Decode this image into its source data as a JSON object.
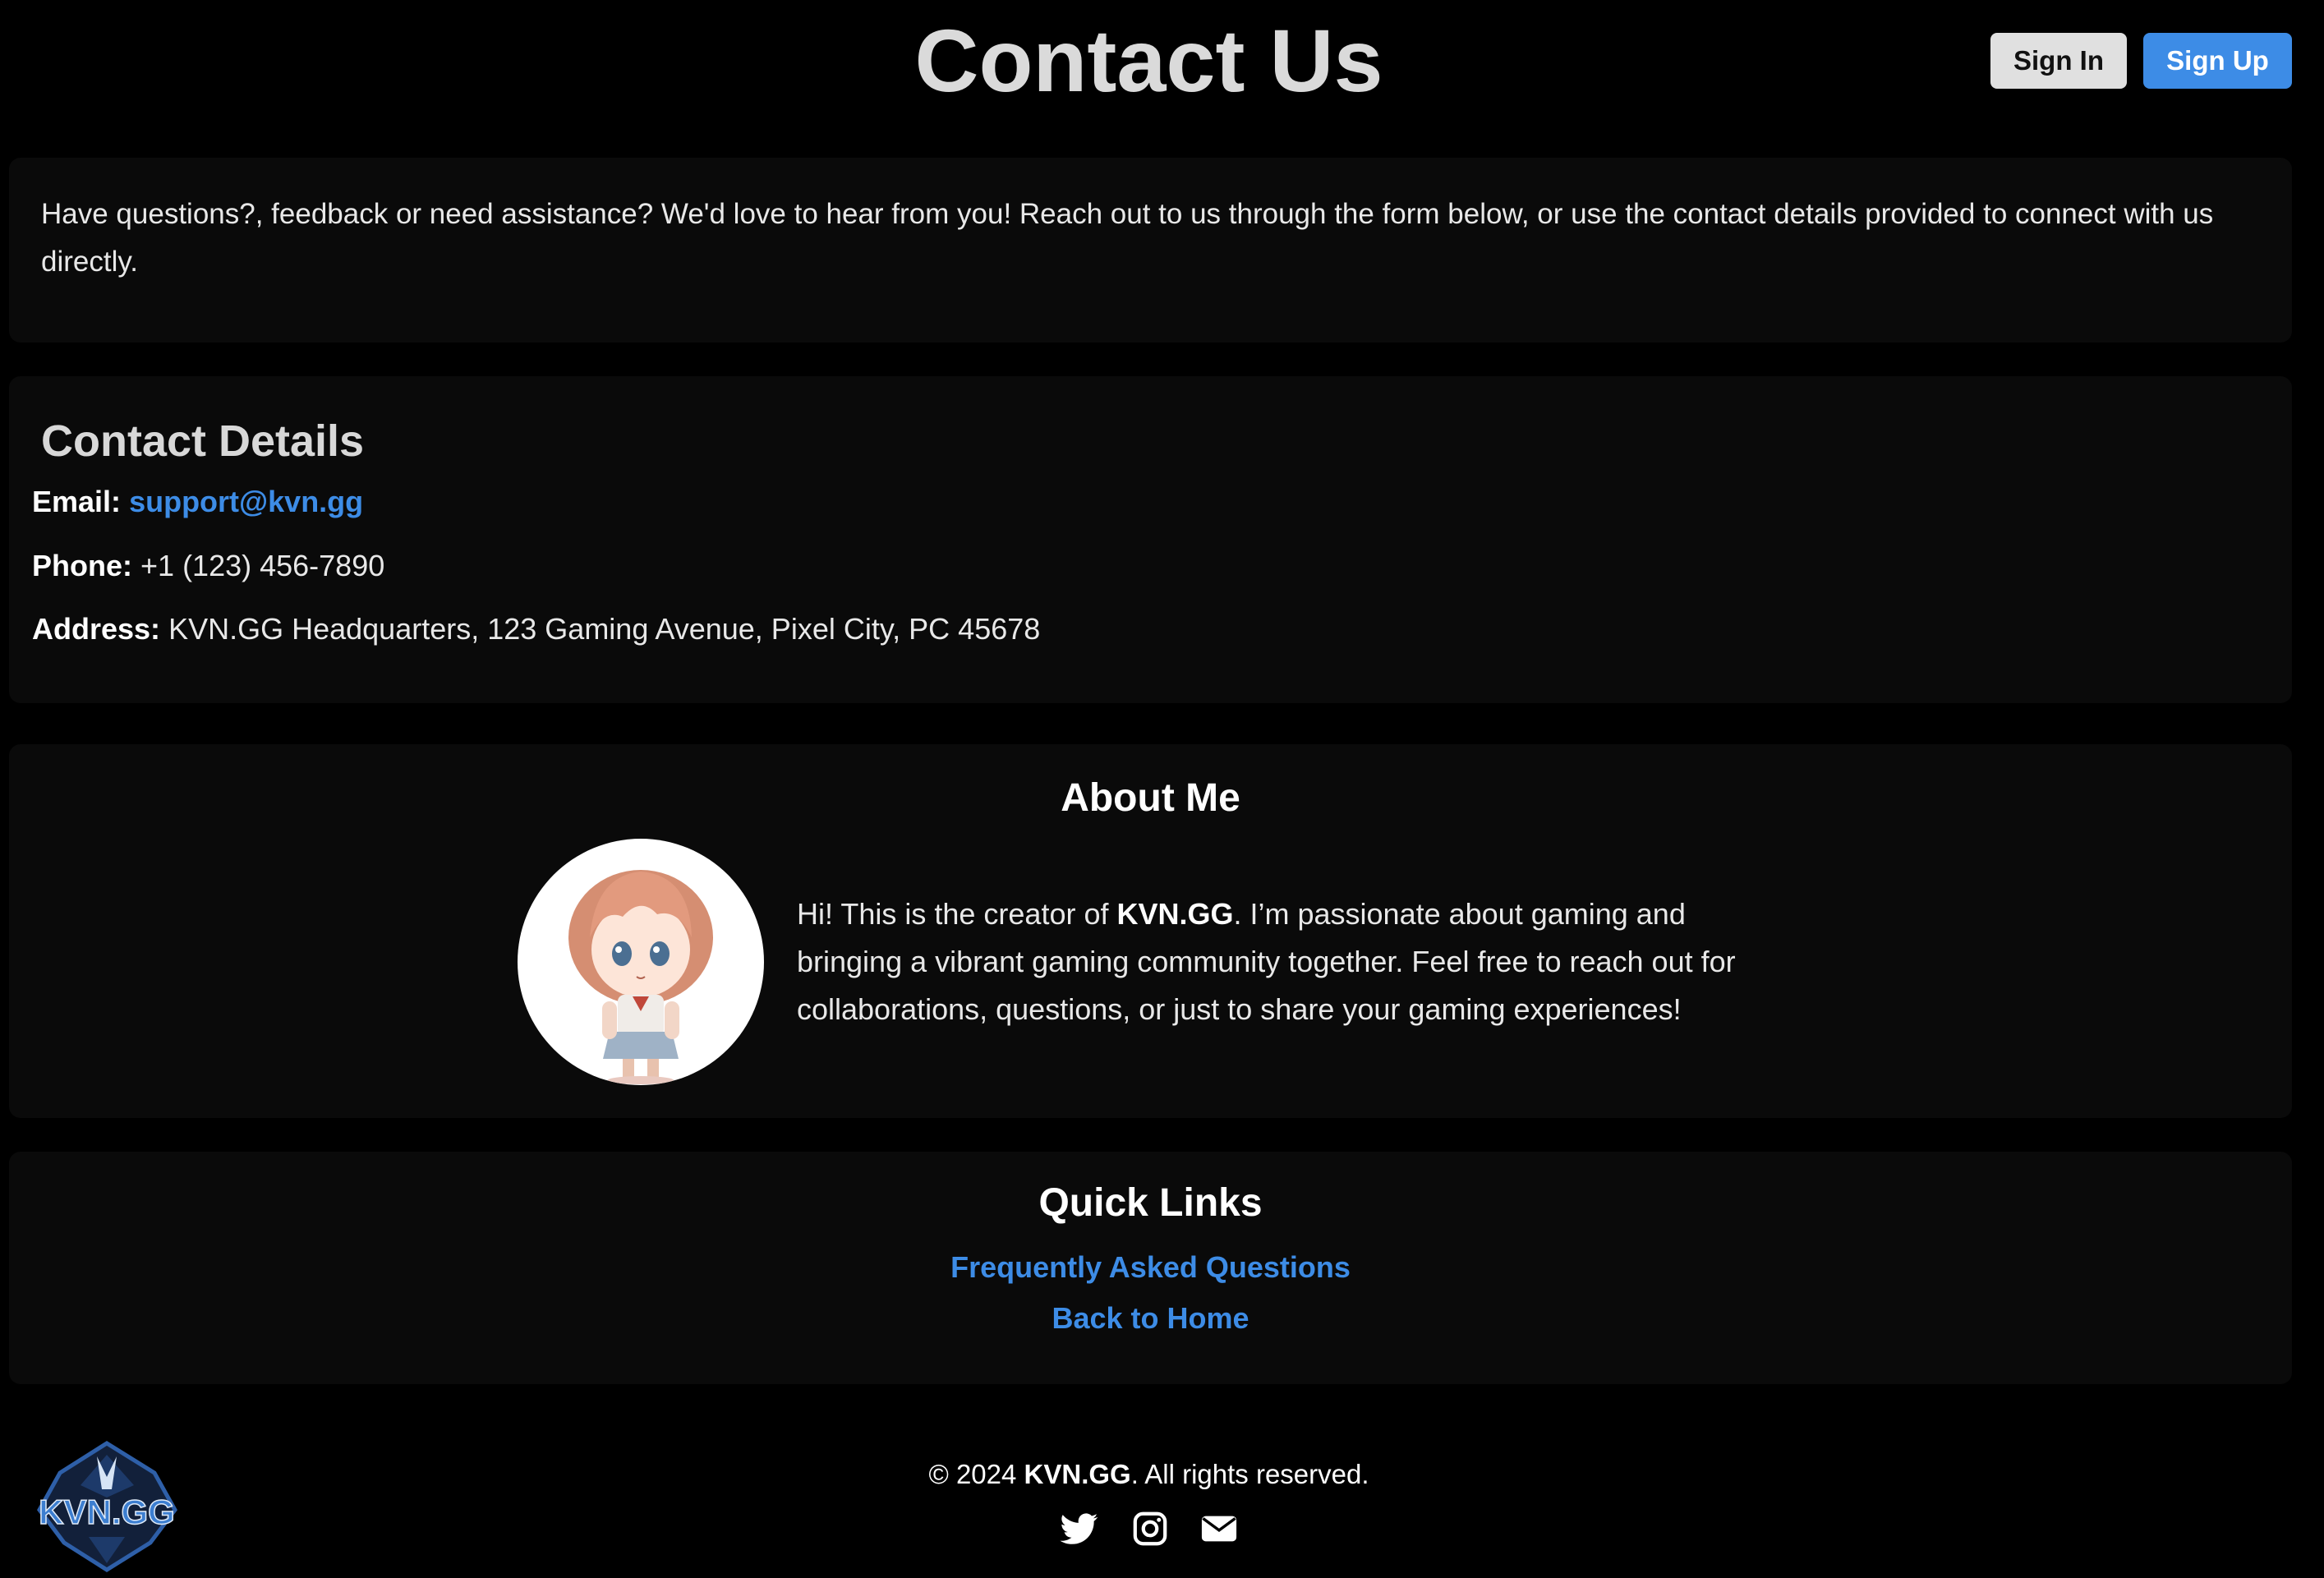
{
  "header": {
    "title": "Contact Us",
    "sign_in_label": "Sign In",
    "sign_up_label": "Sign Up"
  },
  "intro": {
    "text": "Have questions?, feedback or need assistance? We'd love to hear from you! Reach out to us through the form below, or use the contact details provided to connect with us directly."
  },
  "contact_details": {
    "heading": "Contact Details",
    "email_label": "Email:",
    "email_value": "support@kvn.gg",
    "phone_label": "Phone:",
    "phone_value": "+1 (123) 456-7890",
    "address_label": "Address:",
    "address_value": "KVN.GG Headquarters, 123 Gaming Avenue, Pixel City, PC 45678"
  },
  "about": {
    "heading": "About Me",
    "text_prefix": "Hi! This is the creator of ",
    "brand": "KVN.GG",
    "text_suffix": ". I’m passionate about gaming and bringing a vibrant gaming community together. Feel free to reach out for collaborations, questions, or just to share your gaming experiences!",
    "avatar_icon": "anime-avatar-image"
  },
  "quick_links": {
    "heading": "Quick Links",
    "faq": "Frequently Asked Questions",
    "home": "Back to Home"
  },
  "footer": {
    "copyright_prefix": "© 2024 ",
    "brand": "KVN.GG",
    "copyright_suffix": ". All rights reserved.",
    "logo_text": "KVN.GG",
    "icons": [
      "twitter-icon",
      "instagram-icon",
      "mail-icon"
    ]
  },
  "colors": {
    "background": "#000000",
    "card": "#0a0a0a",
    "accent": "#3d8ce6",
    "sign_in_bg": "#e0e0e0"
  }
}
